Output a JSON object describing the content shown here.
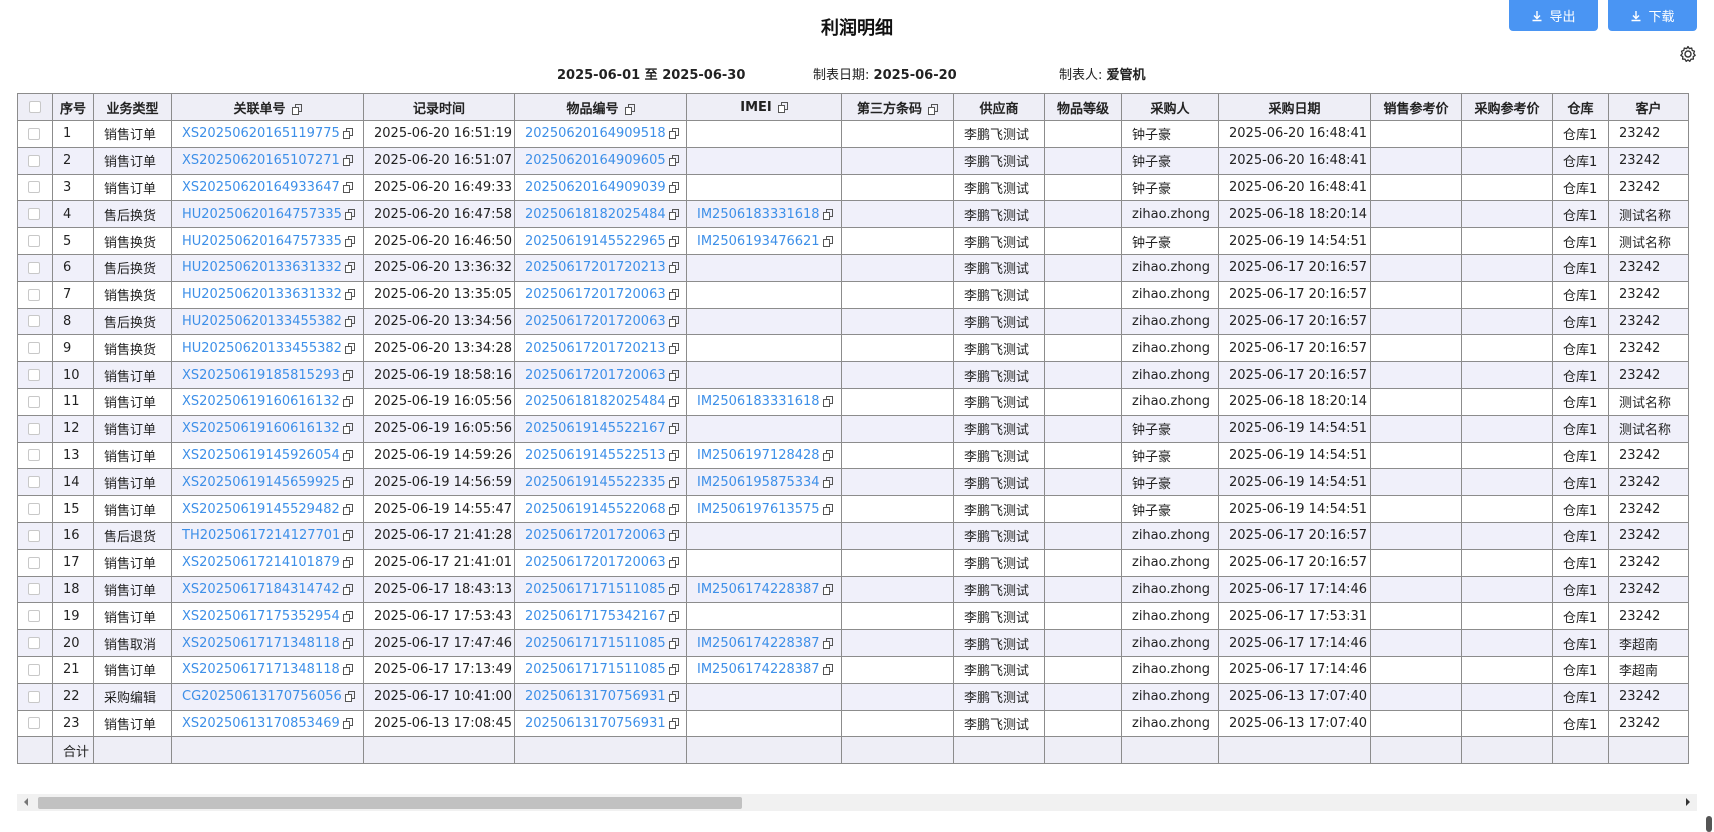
{
  "title": "利润明细",
  "toolbar": {
    "export_label": "导出",
    "download_label": "下载"
  },
  "meta": {
    "range": "2025-06-01 至 2025-06-30",
    "date_label": "制表日期:",
    "date_value": "2025-06-20",
    "maker_label": "制表人:",
    "maker_value": "爱管机"
  },
  "columns": [
    "序号",
    "业务类型",
    "关联单号",
    "记录时间",
    "物品编号",
    "IMEI",
    "第三方条码",
    "供应商",
    "物品等级",
    "采购人",
    "采购日期",
    "销售参考价",
    "采购参考价",
    "仓库",
    "客户"
  ],
  "rows": [
    {
      "no": "1",
      "type": "销售订单",
      "order": "XS20250620165119775",
      "time": "2025-06-20 16:51:19",
      "item": "20250620164909518",
      "imei": "",
      "code3": "",
      "supplier": "李鹏飞测试",
      "grade": "",
      "buyer": "钟子豪",
      "buy_date": "2025-06-20 16:48:41",
      "sale_ref": "",
      "buy_ref": "",
      "wh": "仓库1",
      "customer": "23242"
    },
    {
      "no": "2",
      "type": "销售订单",
      "order": "XS20250620165107271",
      "time": "2025-06-20 16:51:07",
      "item": "20250620164909605",
      "imei": "",
      "code3": "",
      "supplier": "李鹏飞测试",
      "grade": "",
      "buyer": "钟子豪",
      "buy_date": "2025-06-20 16:48:41",
      "sale_ref": "",
      "buy_ref": "",
      "wh": "仓库1",
      "customer": "23242"
    },
    {
      "no": "3",
      "type": "销售订单",
      "order": "XS20250620164933647",
      "time": "2025-06-20 16:49:33",
      "item": "20250620164909039",
      "imei": "",
      "code3": "",
      "supplier": "李鹏飞测试",
      "grade": "",
      "buyer": "钟子豪",
      "buy_date": "2025-06-20 16:48:41",
      "sale_ref": "",
      "buy_ref": "",
      "wh": "仓库1",
      "customer": "23242"
    },
    {
      "no": "4",
      "type": "售后换货",
      "order": "HU20250620164757335",
      "time": "2025-06-20 16:47:58",
      "item": "20250618182025484",
      "imei": "IM2506183331618",
      "code3": "",
      "supplier": "李鹏飞测试",
      "grade": "",
      "buyer": "zihao.zhong",
      "buy_date": "2025-06-18 18:20:14",
      "sale_ref": "",
      "buy_ref": "",
      "wh": "仓库1",
      "customer": "测试名称"
    },
    {
      "no": "5",
      "type": "销售换货",
      "order": "HU20250620164757335",
      "time": "2025-06-20 16:46:50",
      "item": "20250619145522965",
      "imei": "IM2506193476621",
      "code3": "",
      "supplier": "李鹏飞测试",
      "grade": "",
      "buyer": "钟子豪",
      "buy_date": "2025-06-19 14:54:51",
      "sale_ref": "",
      "buy_ref": "",
      "wh": "仓库1",
      "customer": "测试名称"
    },
    {
      "no": "6",
      "type": "售后换货",
      "order": "HU20250620133631332",
      "time": "2025-06-20 13:36:32",
      "item": "20250617201720213",
      "imei": "",
      "code3": "",
      "supplier": "李鹏飞测试",
      "grade": "",
      "buyer": "zihao.zhong",
      "buy_date": "2025-06-17 20:16:57",
      "sale_ref": "",
      "buy_ref": "",
      "wh": "仓库1",
      "customer": "23242"
    },
    {
      "no": "7",
      "type": "销售换货",
      "order": "HU20250620133631332",
      "time": "2025-06-20 13:35:05",
      "item": "20250617201720063",
      "imei": "",
      "code3": "",
      "supplier": "李鹏飞测试",
      "grade": "",
      "buyer": "zihao.zhong",
      "buy_date": "2025-06-17 20:16:57",
      "sale_ref": "",
      "buy_ref": "",
      "wh": "仓库1",
      "customer": "23242"
    },
    {
      "no": "8",
      "type": "售后换货",
      "order": "HU20250620133455382",
      "time": "2025-06-20 13:34:56",
      "item": "20250617201720063",
      "imei": "",
      "code3": "",
      "supplier": "李鹏飞测试",
      "grade": "",
      "buyer": "zihao.zhong",
      "buy_date": "2025-06-17 20:16:57",
      "sale_ref": "",
      "buy_ref": "",
      "wh": "仓库1",
      "customer": "23242"
    },
    {
      "no": "9",
      "type": "销售换货",
      "order": "HU20250620133455382",
      "time": "2025-06-20 13:34:28",
      "item": "20250617201720213",
      "imei": "",
      "code3": "",
      "supplier": "李鹏飞测试",
      "grade": "",
      "buyer": "zihao.zhong",
      "buy_date": "2025-06-17 20:16:57",
      "sale_ref": "",
      "buy_ref": "",
      "wh": "仓库1",
      "customer": "23242"
    },
    {
      "no": "10",
      "type": "销售订单",
      "order": "XS20250619185815293",
      "time": "2025-06-19 18:58:16",
      "item": "20250617201720063",
      "imei": "",
      "code3": "",
      "supplier": "李鹏飞测试",
      "grade": "",
      "buyer": "zihao.zhong",
      "buy_date": "2025-06-17 20:16:57",
      "sale_ref": "",
      "buy_ref": "",
      "wh": "仓库1",
      "customer": "23242"
    },
    {
      "no": "11",
      "type": "销售订单",
      "order": "XS20250619160616132",
      "time": "2025-06-19 16:05:56",
      "item": "20250618182025484",
      "imei": "IM2506183331618",
      "code3": "",
      "supplier": "李鹏飞测试",
      "grade": "",
      "buyer": "zihao.zhong",
      "buy_date": "2025-06-18 18:20:14",
      "sale_ref": "",
      "buy_ref": "",
      "wh": "仓库1",
      "customer": "测试名称"
    },
    {
      "no": "12",
      "type": "销售订单",
      "order": "XS20250619160616132",
      "time": "2025-06-19 16:05:56",
      "item": "20250619145522167",
      "imei": "",
      "code3": "",
      "supplier": "李鹏飞测试",
      "grade": "",
      "buyer": "钟子豪",
      "buy_date": "2025-06-19 14:54:51",
      "sale_ref": "",
      "buy_ref": "",
      "wh": "仓库1",
      "customer": "测试名称"
    },
    {
      "no": "13",
      "type": "销售订单",
      "order": "XS20250619145926054",
      "time": "2025-06-19 14:59:26",
      "item": "20250619145522513",
      "imei": "IM2506197128428",
      "code3": "",
      "supplier": "李鹏飞测试",
      "grade": "",
      "buyer": "钟子豪",
      "buy_date": "2025-06-19 14:54:51",
      "sale_ref": "",
      "buy_ref": "",
      "wh": "仓库1",
      "customer": "23242"
    },
    {
      "no": "14",
      "type": "销售订单",
      "order": "XS20250619145659925",
      "time": "2025-06-19 14:56:59",
      "item": "20250619145522335",
      "imei": "IM2506195875334",
      "code3": "",
      "supplier": "李鹏飞测试",
      "grade": "",
      "buyer": "钟子豪",
      "buy_date": "2025-06-19 14:54:51",
      "sale_ref": "",
      "buy_ref": "",
      "wh": "仓库1",
      "customer": "23242"
    },
    {
      "no": "15",
      "type": "销售订单",
      "order": "XS20250619145529482",
      "time": "2025-06-19 14:55:47",
      "item": "20250619145522068",
      "imei": "IM2506197613575",
      "code3": "",
      "supplier": "李鹏飞测试",
      "grade": "",
      "buyer": "钟子豪",
      "buy_date": "2025-06-19 14:54:51",
      "sale_ref": "",
      "buy_ref": "",
      "wh": "仓库1",
      "customer": "23242"
    },
    {
      "no": "16",
      "type": "售后退货",
      "order": "TH20250617214127701",
      "time": "2025-06-17 21:41:28",
      "item": "20250617201720063",
      "imei": "",
      "code3": "",
      "supplier": "李鹏飞测试",
      "grade": "",
      "buyer": "zihao.zhong",
      "buy_date": "2025-06-17 20:16:57",
      "sale_ref": "",
      "buy_ref": "",
      "wh": "仓库1",
      "customer": "23242"
    },
    {
      "no": "17",
      "type": "销售订单",
      "order": "XS20250617214101879",
      "time": "2025-06-17 21:41:01",
      "item": "20250617201720063",
      "imei": "",
      "code3": "",
      "supplier": "李鹏飞测试",
      "grade": "",
      "buyer": "zihao.zhong",
      "buy_date": "2025-06-17 20:16:57",
      "sale_ref": "",
      "buy_ref": "",
      "wh": "仓库1",
      "customer": "23242"
    },
    {
      "no": "18",
      "type": "销售订单",
      "order": "XS20250617184314742",
      "time": "2025-06-17 18:43:13",
      "item": "20250617171511085",
      "imei": "IM2506174228387",
      "code3": "",
      "supplier": "李鹏飞测试",
      "grade": "",
      "buyer": "zihao.zhong",
      "buy_date": "2025-06-17 17:14:46",
      "sale_ref": "",
      "buy_ref": "",
      "wh": "仓库1",
      "customer": "23242"
    },
    {
      "no": "19",
      "type": "销售订单",
      "order": "XS20250617175352954",
      "time": "2025-06-17 17:53:43",
      "item": "20250617175342167",
      "imei": "",
      "code3": "",
      "supplier": "李鹏飞测试",
      "grade": "",
      "buyer": "zihao.zhong",
      "buy_date": "2025-06-17 17:53:31",
      "sale_ref": "",
      "buy_ref": "",
      "wh": "仓库1",
      "customer": "23242"
    },
    {
      "no": "20",
      "type": "销售取消",
      "order": "XS20250617171348118",
      "time": "2025-06-17 17:47:46",
      "item": "20250617171511085",
      "imei": "IM2506174228387",
      "code3": "",
      "supplier": "李鹏飞测试",
      "grade": "",
      "buyer": "zihao.zhong",
      "buy_date": "2025-06-17 17:14:46",
      "sale_ref": "",
      "buy_ref": "",
      "wh": "仓库1",
      "customer": "李超南"
    },
    {
      "no": "21",
      "type": "销售订单",
      "order": "XS20250617171348118",
      "time": "2025-06-17 17:13:49",
      "item": "20250617171511085",
      "imei": "IM2506174228387",
      "code3": "",
      "supplier": "李鹏飞测试",
      "grade": "",
      "buyer": "zihao.zhong",
      "buy_date": "2025-06-17 17:14:46",
      "sale_ref": "",
      "buy_ref": "",
      "wh": "仓库1",
      "customer": "李超南"
    },
    {
      "no": "22",
      "type": "采购编辑",
      "order": "CG20250613170756056",
      "time": "2025-06-17 10:41:00",
      "item": "20250613170756931",
      "imei": "",
      "code3": "",
      "supplier": "李鹏飞测试",
      "grade": "",
      "buyer": "zihao.zhong",
      "buy_date": "2025-06-13 17:07:40",
      "sale_ref": "",
      "buy_ref": "",
      "wh": "仓库1",
      "customer": "23242"
    },
    {
      "no": "23",
      "type": "销售订单",
      "order": "XS20250613170853469",
      "time": "2025-06-13 17:08:45",
      "item": "20250613170756931",
      "imei": "",
      "code3": "",
      "supplier": "李鹏飞测试",
      "grade": "",
      "buyer": "zihao.zhong",
      "buy_date": "2025-06-13 17:07:40",
      "sale_ref": "",
      "buy_ref": "",
      "wh": "仓库1",
      "customer": "23242"
    }
  ],
  "footer": {
    "total_label": "合计"
  },
  "icons": {
    "export": "download-icon",
    "download": "download-icon",
    "settings": "gear-icon",
    "copy": "copy-icon"
  },
  "colors": {
    "accent": "#4a95f3",
    "link": "#3d8fe8",
    "header_bg": "#eeeef6",
    "stripe_bg": "#f0f0fa"
  }
}
